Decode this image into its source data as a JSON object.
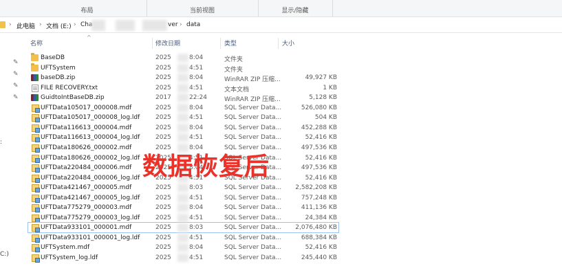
{
  "ribbon": {
    "groups": [
      "布局",
      "当前视图",
      "显示/隐藏"
    ]
  },
  "address": {
    "crumbs": [
      "此电脑",
      "文档 (E:)",
      "Cha",
      "ver",
      "data"
    ]
  },
  "columns": {
    "name": "名称",
    "date": "修改日期",
    "type": "类型",
    "size": "大小"
  },
  "nav": {
    "drive_fragment": "C:)"
  },
  "files": [
    {
      "name": "BaseDB",
      "date": "2025",
      "time": "8:04",
      "type": "文件夹",
      "size": "",
      "icon": "folder-icon"
    },
    {
      "name": "UFTSystem",
      "date": "2025",
      "time": "4:51",
      "type": "文件夹",
      "size": "",
      "icon": "folder-icon"
    },
    {
      "name": "baseDB.zip",
      "date": "2025",
      "time": "8:04",
      "type": "WinRAR ZIP 压缩...",
      "size": "49,927 KB",
      "icon": "winrar-zip-icon"
    },
    {
      "name": "FILE RECOVERY.txt",
      "date": "2025",
      "time": "4:51",
      "type": "文本文档",
      "size": "1 KB",
      "icon": "text-file-icon"
    },
    {
      "name": "GuidtoIntBaseDB.zip",
      "date": "2017",
      "time": "22:24",
      "type": "WinRAR ZIP 压缩...",
      "size": "5,128 KB",
      "icon": "winrar-zip-icon"
    },
    {
      "name": "UFTData105017_000008.mdf",
      "date": "2025",
      "time": "8:04",
      "type": "SQL Server Data...",
      "size": "526,080 KB",
      "icon": "sql-data-file-icon"
    },
    {
      "name": "UFTData105017_000008_log.ldf",
      "date": "2025",
      "time": "4:51",
      "type": "SQL Server Data...",
      "size": "504 KB",
      "icon": "sql-data-file-icon"
    },
    {
      "name": "UFTData116613_000004.mdf",
      "date": "2025",
      "time": "8:04",
      "type": "SQL Server Data...",
      "size": "452,288 KB",
      "icon": "sql-data-file-icon"
    },
    {
      "name": "UFTData116613_000004_log.ldf",
      "date": "2025",
      "time": "4:51",
      "type": "SQL Server Data...",
      "size": "52,416 KB",
      "icon": "sql-data-file-icon"
    },
    {
      "name": "UFTData180626_000002.mdf",
      "date": "2025",
      "time": "8:04",
      "type": "SQL Server Data...",
      "size": "497,536 KB",
      "icon": "sql-data-file-icon"
    },
    {
      "name": "UFTData180626_000002_log.ldf",
      "date": "2025",
      "time": "4:51",
      "type": "SQL Server Data...",
      "size": "52,416 KB",
      "icon": "sql-data-file-icon"
    },
    {
      "name": "UFTData220484_000006.mdf",
      "date": "2025",
      "time": "8:04",
      "type": "SQL Server Data...",
      "size": "497,536 KB",
      "icon": "sql-data-file-icon"
    },
    {
      "name": "UFTData220484_000006_log.ldf",
      "date": "2025",
      "time": "4:51",
      "type": "SQL Server Data...",
      "size": "52,416 KB",
      "icon": "sql-data-file-icon"
    },
    {
      "name": "UFTData421467_000005.mdf",
      "date": "2025",
      "time": "8:03",
      "type": "SQL Server Data...",
      "size": "2,582,208 KB",
      "icon": "sql-data-file-icon"
    },
    {
      "name": "UFTData421467_000005_log.ldf",
      "date": "2025",
      "time": "4:51",
      "type": "SQL Server Data...",
      "size": "757,248 KB",
      "icon": "sql-data-file-icon"
    },
    {
      "name": "UFTData775279_000003.mdf",
      "date": "2025",
      "time": "8:04",
      "type": "SQL Server Data...",
      "size": "411,136 KB",
      "icon": "sql-data-file-icon"
    },
    {
      "name": "UFTData775279_000003_log.ldf",
      "date": "2025",
      "time": "4:51",
      "type": "SQL Server Data...",
      "size": "24,384 KB",
      "icon": "sql-data-file-icon"
    },
    {
      "name": "UFTData933101_000001.mdf",
      "date": "2025",
      "time": "8:03",
      "type": "SQL Server Data...",
      "size": "2,076,480 KB",
      "icon": "sql-data-file-icon"
    },
    {
      "name": "UFTData933101_000001_log.ldf",
      "date": "2025",
      "time": "4:51",
      "type": "SQL Server Data...",
      "size": "688,384 KB",
      "icon": "sql-data-file-icon"
    },
    {
      "name": "UFTSystem.mdf",
      "date": "2025",
      "time": "8:04",
      "type": "SQL Server Data...",
      "size": "52,416 KB",
      "icon": "sql-data-file-icon"
    },
    {
      "name": "UFTSystem_log.ldf",
      "date": "2025",
      "time": "4:51",
      "type": "SQL Server Data...",
      "size": "245,440 KB",
      "icon": "sql-data-file-icon"
    }
  ],
  "selected_file": "UFTData933101_000001.mdf",
  "overlay_text": "数据恢复后"
}
